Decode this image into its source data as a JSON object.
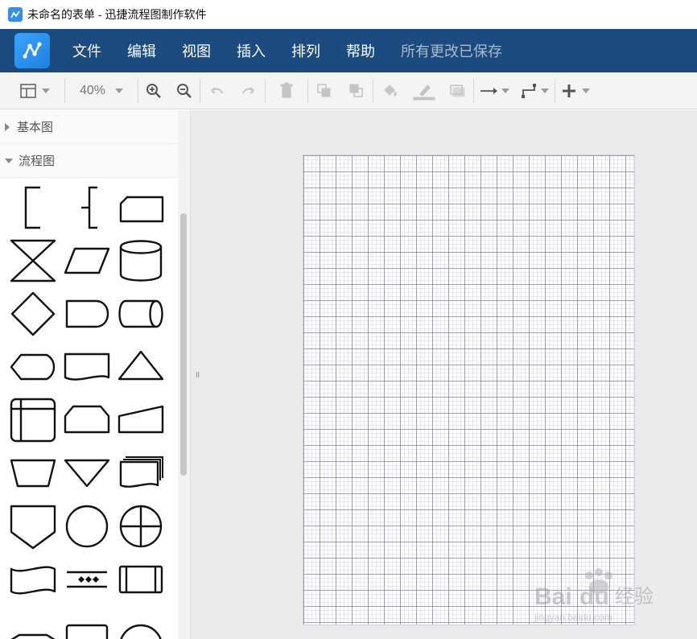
{
  "window": {
    "title": "未命名的表单 - 迅捷流程图制作软件"
  },
  "menubar": {
    "items": [
      "文件",
      "编辑",
      "视图",
      "插入",
      "排列",
      "帮助"
    ],
    "status": "所有更改已保存"
  },
  "toolbar": {
    "zoom": "40%"
  },
  "sidebar": {
    "categories": [
      {
        "label": "基本图",
        "expanded": false
      },
      {
        "label": "流程图",
        "expanded": true
      }
    ]
  },
  "splitter": {
    "grip": "॥"
  },
  "colors": {
    "menubar": "#1c4b80",
    "accent": "#2f8ef0",
    "grid_major": "#5a5adc",
    "canvas_bg": "#ebebeb"
  },
  "icons": {
    "toolbar": [
      "format-panel-icon",
      "zoom-in-icon",
      "zoom-out-icon",
      "undo-icon",
      "redo-icon",
      "delete-icon",
      "to-front-icon",
      "to-back-icon",
      "fill-color-icon",
      "line-color-icon",
      "shadow-icon",
      "connection-arrow-icon",
      "waypoint-icon",
      "insert-plus-icon"
    ]
  },
  "shapes": [
    "annotation-bracket",
    "annotation-brace",
    "card",
    "collate",
    "data",
    "database",
    "decision",
    "delay",
    "direct-data",
    "display",
    "document",
    "extract",
    "internal-storage",
    "loop-limit",
    "manual-input",
    "manual-operation",
    "merge",
    "multi-document",
    "off-page-connector",
    "on-page-connector",
    "or",
    "paper-tape",
    "parallel-mode",
    "predefined-process",
    "process",
    "start-end",
    "summing-junction"
  ]
}
